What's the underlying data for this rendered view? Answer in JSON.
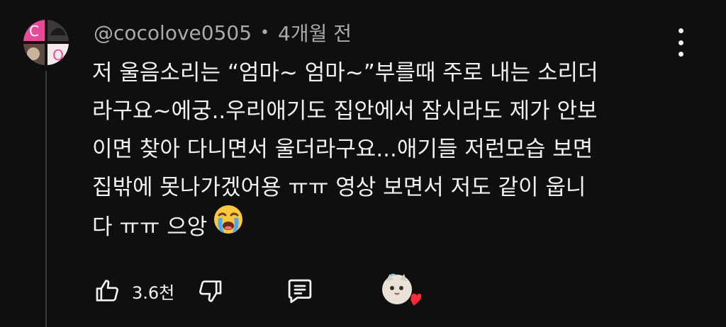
{
  "comment": {
    "author": "@cocolove0505",
    "separator": "•",
    "time": "4개월 전",
    "text_lines": [
      "저 울음소리는 “엄마~ 엄마~”부를때 주로 내는 소리더",
      "라구요~에궁..우리애기도 집안에서 잠시라도 제가 안보",
      "이면 찾아 다니면서 울더라구요...애기들 저런모습 보면",
      "집밖에 못나가겠어용 ㅠㅠ 영상 보면서 저도 같이 웁니",
      "다 ㅠㅠ 으앙"
    ],
    "emoji": "loudly-crying-face",
    "like_count": "3.6천"
  },
  "avatar_letters": [
    "C",
    "O"
  ],
  "colors": {
    "background": "#0f0f0f",
    "primary_text": "#f1f1f1",
    "secondary_text": "#aaaaaa",
    "avatar_accent": "#e64b9a",
    "heart": "#ff2b3a"
  },
  "icons": [
    "kebab-menu-icon",
    "thumbs-up-icon",
    "thumbs-down-icon",
    "reply-comment-icon",
    "creator-heart-icon"
  ]
}
